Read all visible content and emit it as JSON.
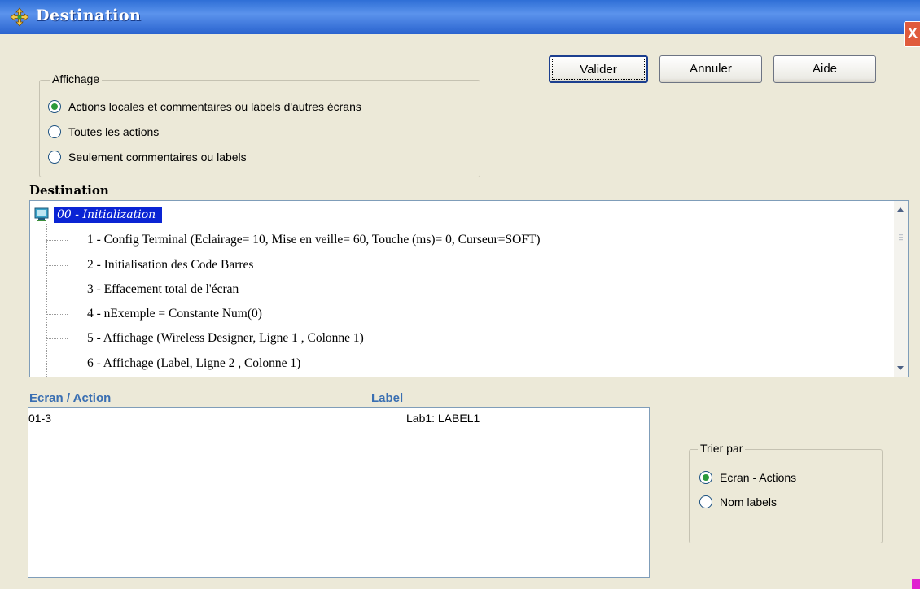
{
  "window": {
    "title": "Destination",
    "close_label": "X"
  },
  "buttons": {
    "validate": "Valider",
    "cancel": "Annuler",
    "help": "Aide"
  },
  "display_group": {
    "legend": "Affichage",
    "options": [
      {
        "label": "Actions locales et commentaires ou labels d'autres écrans",
        "checked": true
      },
      {
        "label": "Toutes les actions",
        "checked": false
      },
      {
        "label": "Seulement commentaires ou labels",
        "checked": false
      }
    ]
  },
  "tree": {
    "section_title": "Destination",
    "root_label": "00 - Initialization",
    "items": [
      "1 - Config Terminal (Eclairage= 10, Mise en veille= 60, Touche (ms)= 0, Curseur=SOFT)",
      "2 - Initialisation des Code Barres",
      "3 - Effacement total de l'écran",
      "4 - nExemple = Constante Num(0)",
      "5 - Affichage (Wireless Designer, Ligne 1 , Colonne 1)",
      "6 - Affichage (Label, Ligne 2 , Colonne 1)"
    ]
  },
  "list": {
    "col_screen_action": "Ecran / Action",
    "col_label": "Label",
    "rows": [
      {
        "screen_action": "01-3",
        "label": "Lab1: LABEL1"
      }
    ]
  },
  "sort_group": {
    "legend": "Trier par",
    "options": [
      {
        "label": "Ecran - Actions",
        "checked": true
      },
      {
        "label": "Nom labels",
        "checked": false
      }
    ]
  },
  "colors": {
    "titlebar": "#2f6fd6",
    "selection": "#0a24d4",
    "column_header": "#3a6fb2"
  }
}
